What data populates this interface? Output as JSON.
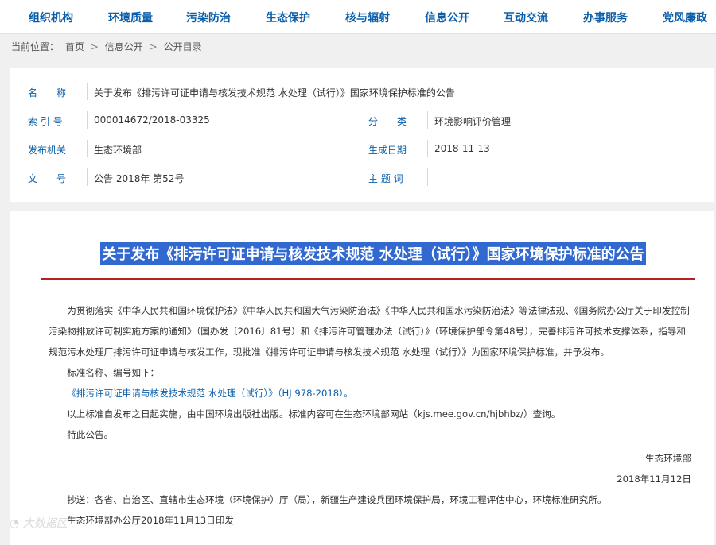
{
  "nav": {
    "items": [
      "组织机构",
      "环境质量",
      "污染防治",
      "生态保护",
      "核与辐射",
      "信息公开",
      "互动交流",
      "办事服务",
      "党风廉政"
    ]
  },
  "breadcrumb": {
    "label": "当前位置：",
    "items": [
      "首页",
      "信息公开",
      "公开目录"
    ],
    "sep": ">"
  },
  "meta": {
    "name_label": "名　　称",
    "name_value": "关于发布《排污许可证申请与核发技术规范 水处理（试行）》国家环境保护标准的公告",
    "index_label": "索 引 号",
    "index_value": "000014672/2018-03325",
    "category_label": "分　　类",
    "category_value": "环境影响评价管理",
    "issuer_label": "发布机关",
    "issuer_value": "生态环境部",
    "date_label": "生成日期",
    "date_value": "2018-11-13",
    "docno_label": "文　　号",
    "docno_value": "公告 2018年 第52号",
    "subject_label": "主 题 词",
    "subject_value": ""
  },
  "article": {
    "title": "关于发布《排污许可证申请与核发技术规范 水处理（试行）》国家环境保护标准的公告",
    "para1": "为贯彻落实《中华人民共和国环境保护法》《中华人民共和国大气污染防治法》《中华人民共和国水污染防治法》等法律法规、《国务院办公厅关于印发控制污染物排放许可制实施方案的通知》（国办发〔2016〕81号）和《排污许可管理办法（试行）》（环境保护部令第48号），完善排污许可技术支撑体系，指导和规范污水处理厂排污许可证申请与核发工作，现批准《排污许可证申请与核发技术规范 水处理（试行）》为国家环境保护标准，并予发布。",
    "para2": "标准名称、编号如下：",
    "standard_link": "《排污许可证申请与核发技术规范 水处理（试行）》（HJ 978-2018）。",
    "para3": "以上标准自发布之日起实施，由中国环境出版社出版。标准内容可在生态环境部网站（kjs.mee.gov.cn/hjbhbz/）查询。",
    "para4": "特此公告。",
    "signer": "生态环境部",
    "sign_date": "2018年11月12日",
    "cc": "抄送：各省、自治区、直辖市生态环境（环境保护）厅（局），新疆生产建设兵团环境保护局，环境工程评估中心，环境标准研究所。",
    "print_note": "生态环境部办公厅2018年11月13日印发"
  },
  "watermark": "大数据区"
}
